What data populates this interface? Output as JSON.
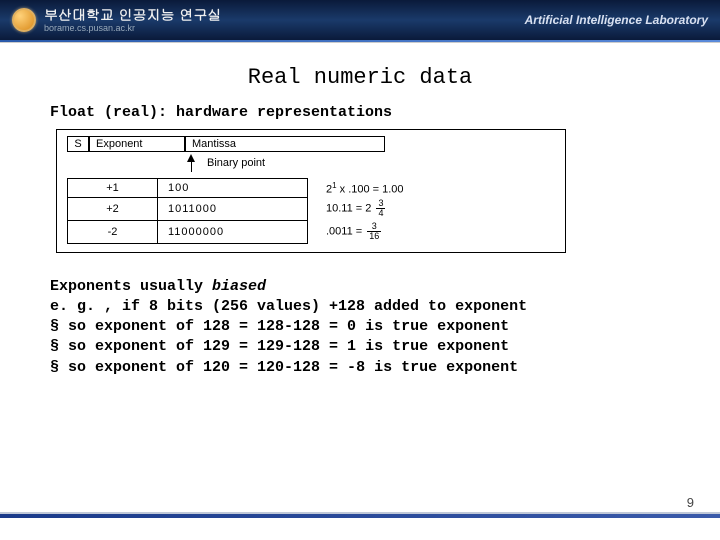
{
  "header": {
    "org_title": "부산대학교 인공지능 연구실",
    "org_sub": "borame.cs.pusan.ac.kr",
    "lab": "Artificial Intelligence Laboratory"
  },
  "title": "Real numeric data",
  "subtitle": "Float (real): hardware representations",
  "diagram": {
    "s": "S",
    "exp": "Exponent",
    "man": "Mantissa",
    "bp": "Binary point",
    "rows": [
      {
        "exp": "+1",
        "man": "100",
        "res_prefix": "2",
        "res_sup": "1",
        "res_mid": " x .100 = 1.00"
      },
      {
        "exp": "+2",
        "man": "1011000",
        "res_plain": "10.11 = 2",
        "frac_n": "3",
        "frac_d": "4"
      },
      {
        "exp": "-2",
        "man": "11000000",
        "res_plain": ".0011 = ",
        "frac_n": "3",
        "frac_d": "16"
      }
    ]
  },
  "body": {
    "line1a": "Exponents usually ",
    "line1b": "biased",
    "line2": "e. g. , if 8 bits (256 values) +128 added to exponent",
    "b1": "so exponent of 128 = 128-128 = 0 is true exponent",
    "b2": "so exponent of 129 = 129-128 = 1 is true exponent",
    "b3": "so exponent of 120 = 120-128 = -8 is true exponent"
  },
  "page": "9"
}
